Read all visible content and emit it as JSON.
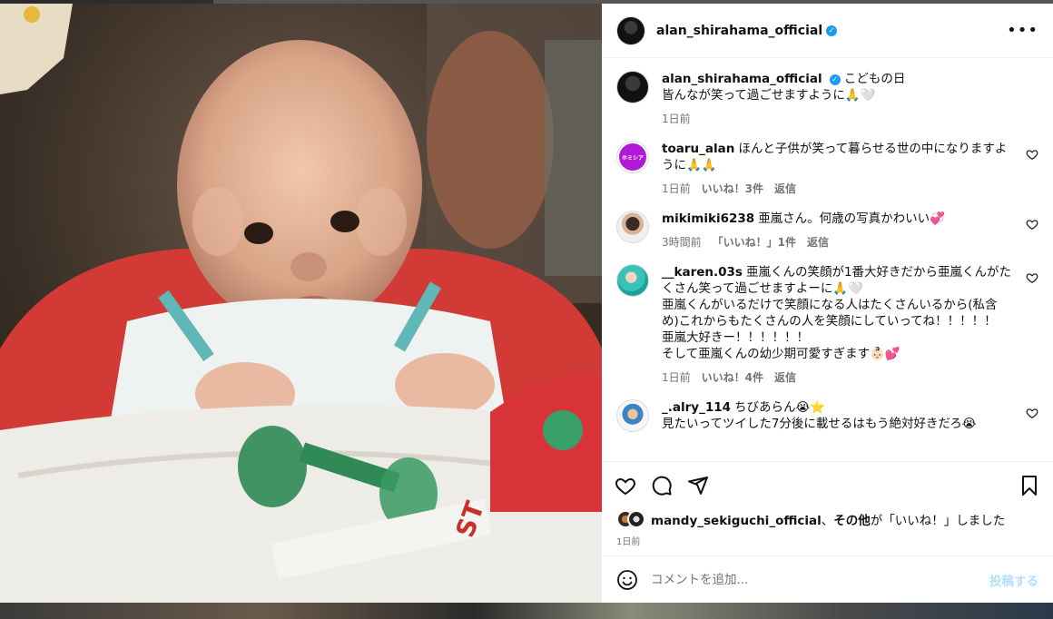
{
  "post": {
    "author": "alan_shirahama_official",
    "caption_line1": "こどもの日",
    "caption_line2": "皆んなが笑って過ごせますように🙏🤍",
    "time": "1日前",
    "image_alt": "baby photo"
  },
  "comments": [
    {
      "user": "toaru_alan",
      "text": "ほんと子供が笑って暮らせる世の中になりますように🙏🙏",
      "time": "1日前",
      "likes": "いいね！3件",
      "reply": "返信",
      "avatar_text": "ホミシア"
    },
    {
      "user": "mikimiki6238",
      "text": "亜嵐さん。何歳の写真かわいい💞",
      "time": "3時間前",
      "likes": "「いいね！」1件",
      "reply": "返信"
    },
    {
      "user": "__karen.03s",
      "text": "亜嵐くんの笑顔が1番大好きだから亜嵐くんがたくさん笑って過ごせますよーに🙏🤍",
      "text2": "亜嵐くんがいるだけで笑顔になる人はたくさんいるから(私含め)これからもたくさんの人を笑顔にしていってね！！！！！",
      "text3": "亜嵐大好きー！！！！！！",
      "text4": "そして亜嵐くんの幼少期可愛すぎます👶🏻💕",
      "time": "1日前",
      "likes": "いいね！4件",
      "reply": "返信"
    },
    {
      "user": "_.alry_114",
      "text": "ちびあらん😭⭐️",
      "text2": "見たいってツイした7分後に載せるはもう絶対好きだろ😭"
    }
  ],
  "likes_bar": {
    "liker": "mandy_sekiguchi_official",
    "sep": "、",
    "others": "その他",
    "suffix": "が「いいね！」しました",
    "date": "1日前"
  },
  "compose": {
    "placeholder": "コメントを追加...",
    "post_label": "投稿する"
  },
  "icons": [
    "more-icon",
    "heart-icon",
    "comment-icon",
    "share-icon",
    "bookmark-icon",
    "emoji-icon",
    "verified-icon"
  ]
}
